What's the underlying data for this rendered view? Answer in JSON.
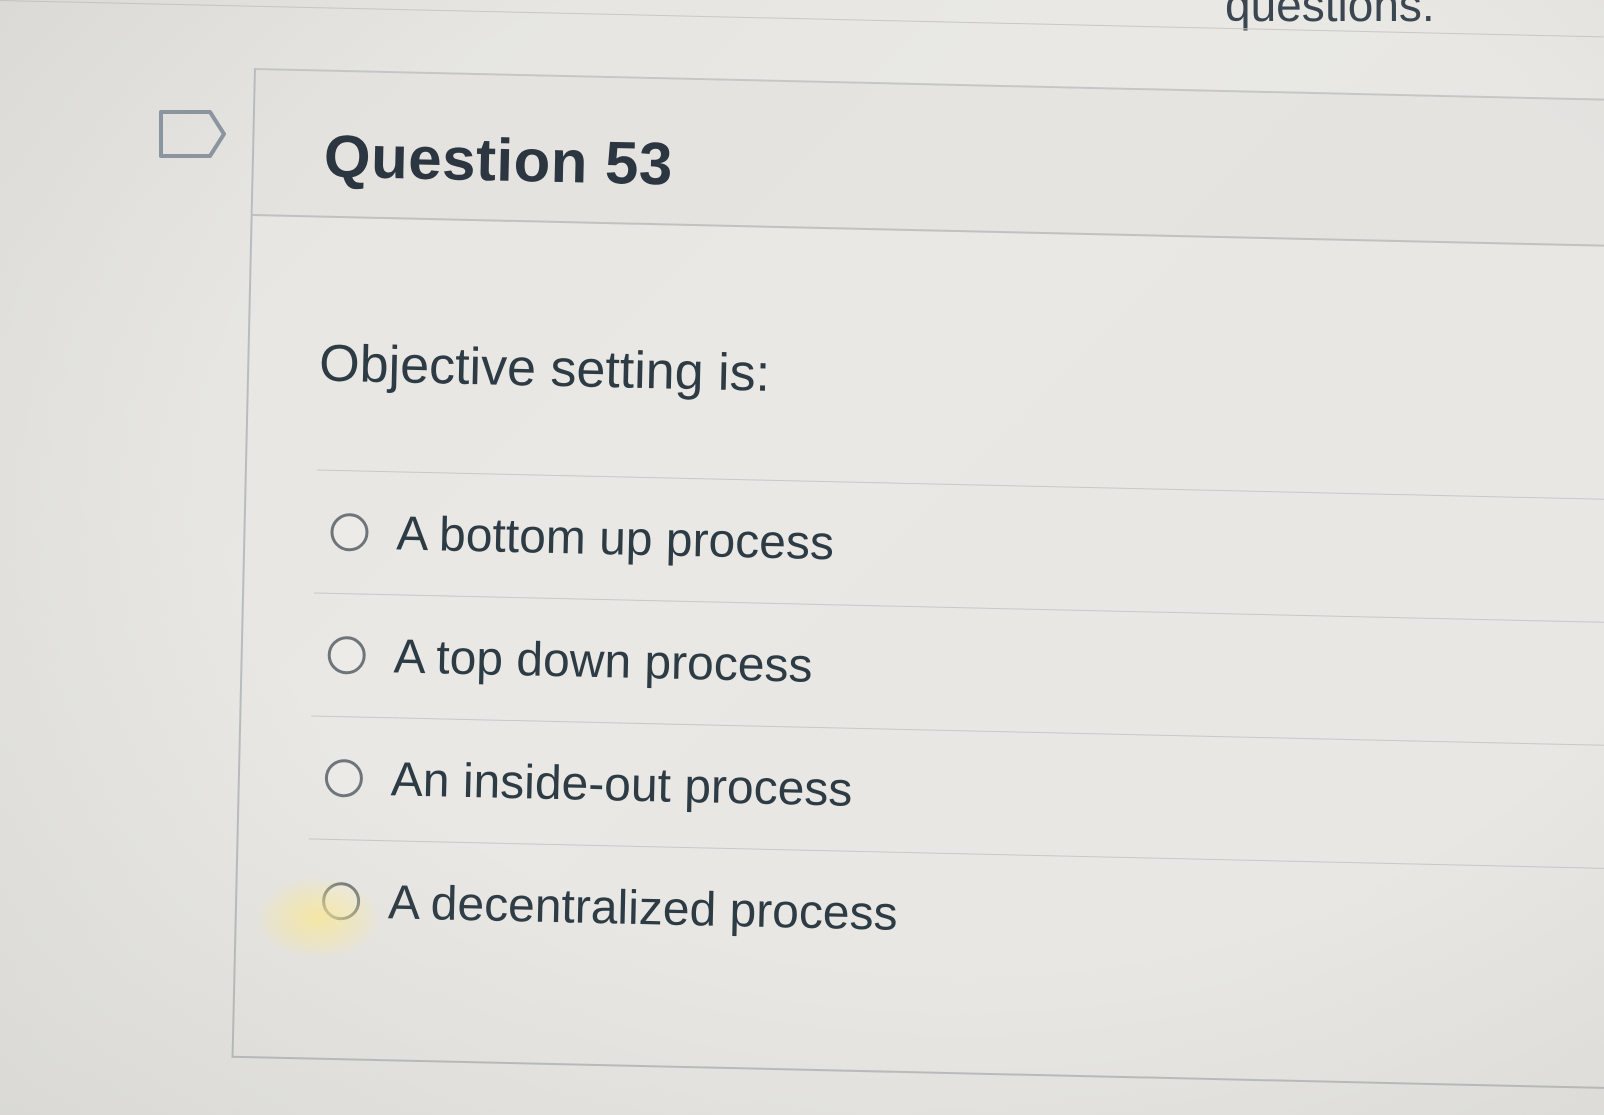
{
  "header": {
    "fragment_text": "questions."
  },
  "question": {
    "title": "Question 53",
    "prompt": "Objective setting is:",
    "flag_icon": "bookmark-flag-outline-icon",
    "options": [
      {
        "label": "A bottom up process",
        "selected": false
      },
      {
        "label": "A top down process",
        "selected": false
      },
      {
        "label": "An inside-out process",
        "selected": false
      },
      {
        "label": "A decentralized process",
        "selected": false
      }
    ]
  },
  "colors": {
    "background": "#e6e5e1",
    "text": "#2d3b45",
    "border": "#b9bcbf",
    "radio_border": "#6d757b"
  }
}
